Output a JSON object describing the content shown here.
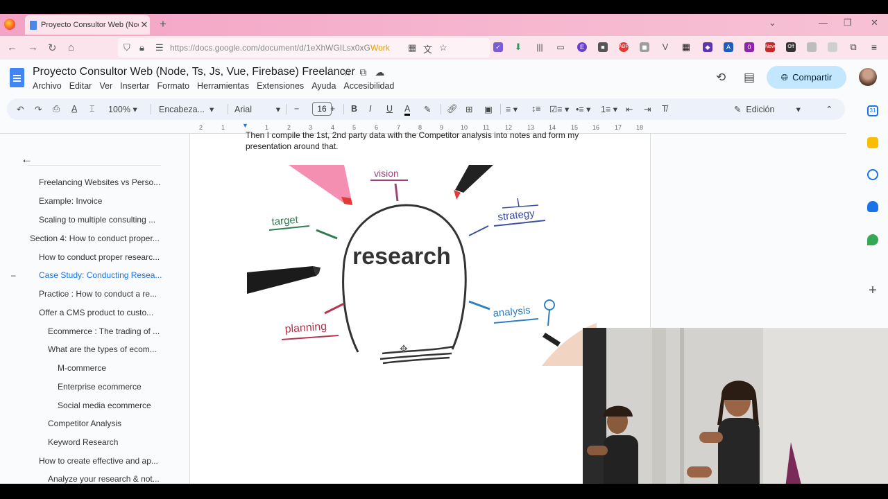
{
  "browser": {
    "tab_title": "Proyecto Consultor Web (Node",
    "url": "https://docs.google.com/document/d/1eXhWGILsx0xG",
    "url_badge": "Work"
  },
  "docs": {
    "title": "Proyecto Consultor Web (Node, Ts, Js, Vue, Firebase) Freelancer",
    "menus": [
      "Archivo",
      "Editar",
      "Ver",
      "Insertar",
      "Formato",
      "Herramientas",
      "Extensiones",
      "Ayuda",
      "Accesibilidad"
    ],
    "share_label": "Compartir",
    "toolbar": {
      "zoom": "100%",
      "style": "Encabeza...",
      "font": "Arial",
      "font_size": "16",
      "mode": "Edición"
    },
    "ruler": [
      "2",
      "1",
      "1",
      "2",
      "3",
      "4",
      "5",
      "6",
      "7",
      "8",
      "9",
      "10",
      "11",
      "12",
      "13",
      "14",
      "15",
      "16",
      "17",
      "18"
    ]
  },
  "outline": {
    "items": [
      {
        "label": "Freelancing Websites vs Perso...",
        "level": 2
      },
      {
        "label": "Example: Invoice",
        "level": 2
      },
      {
        "label": "Scaling to multiple consulting ...",
        "level": 2
      },
      {
        "label": "Section 4: How to conduct proper...",
        "level": 1
      },
      {
        "label": "How to conduct proper researc...",
        "level": 2
      },
      {
        "label": "Case Study: Conducting Resea...",
        "level": 2,
        "active": true
      },
      {
        "label": "Practice : How to conduct a re...",
        "level": 2
      },
      {
        "label": "Offer a CMS product to custo...",
        "level": 2
      },
      {
        "label": "Ecommerce : The trading of ...",
        "level": 3
      },
      {
        "label": "What are the types of ecom...",
        "level": 3
      },
      {
        "label": "M-commerce",
        "level": 4
      },
      {
        "label": "Enterprise ecommerce",
        "level": 4
      },
      {
        "label": "Social media ecommerce",
        "level": 4
      },
      {
        "label": "Competitor Analysis",
        "level": 3
      },
      {
        "label": "Keyword Research",
        "level": 3
      },
      {
        "label": "How to create effective and ap...",
        "level": 2
      },
      {
        "label": "Analyze your research & not...",
        "level": 3
      }
    ]
  },
  "page": {
    "body_text": "Then I compile the 1st, 2nd party data with the Competitor analysis into notes and form my presentation around that.",
    "illustration": {
      "center": "research",
      "labels": {
        "vision": "vision",
        "strategy": "strategy",
        "target": "target",
        "planning": "planning",
        "analysis": "analysis"
      }
    }
  },
  "colors": {
    "accent": "#1a73e8",
    "share_bg": "#c2e7ff",
    "tabstrip": "#f3a3c4"
  }
}
